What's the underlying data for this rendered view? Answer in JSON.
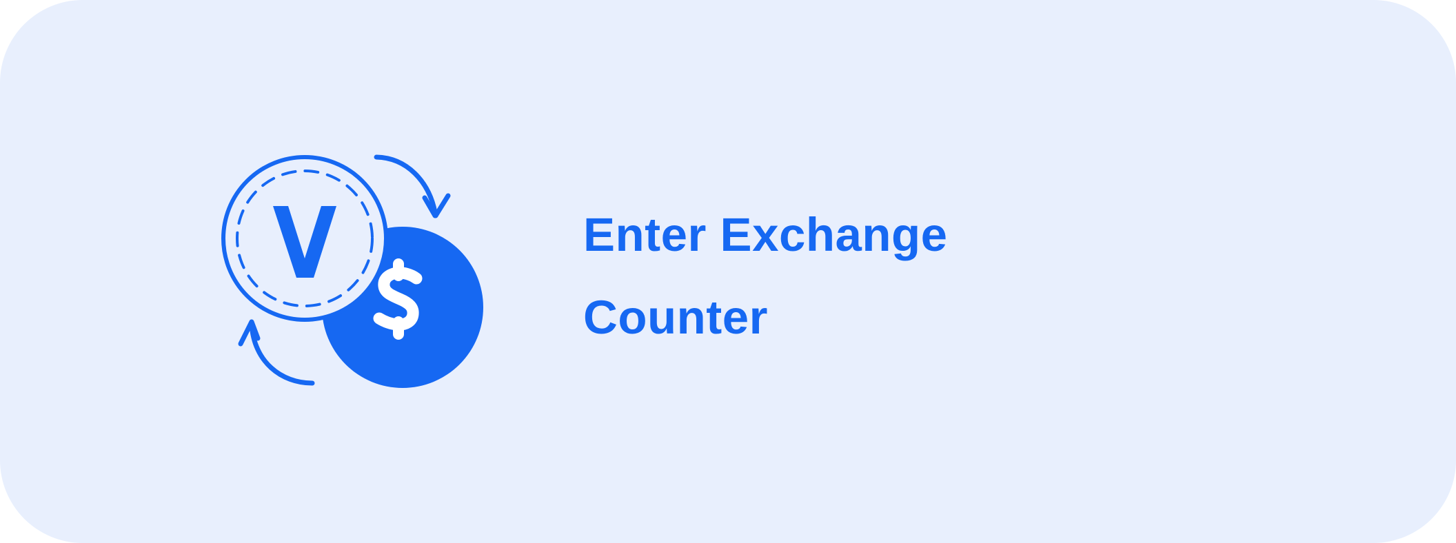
{
  "button": {
    "label_line_1": "Enter Exchange",
    "label_line_2": "Counter"
  },
  "icons": {
    "main": "currency-exchange-icon",
    "coin": "v-coin-icon",
    "dollar": "dollar-coin-icon",
    "arrows": "circular-arrows-icon"
  },
  "colors": {
    "background": "#e8effd",
    "accent": "#1668f2"
  }
}
